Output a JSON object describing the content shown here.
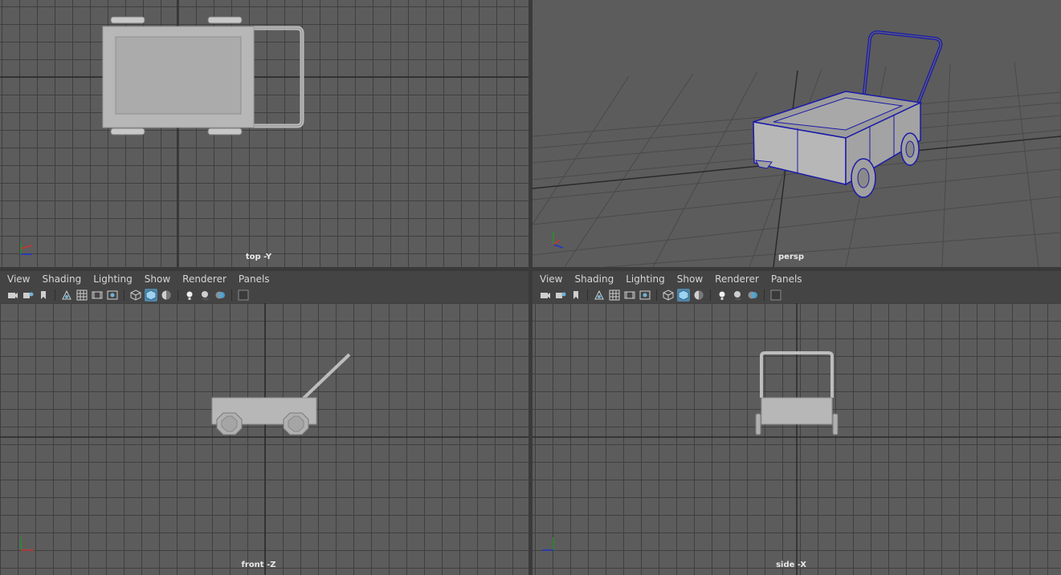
{
  "viewports": {
    "top": {
      "label": "top -Y"
    },
    "persp": {
      "label": "persp"
    },
    "front": {
      "label": "front -Z"
    },
    "side": {
      "label": "side -X"
    }
  },
  "panel_menu": {
    "view": "View",
    "shading": "Shading",
    "lighting": "Lighting",
    "show": "Show",
    "renderer": "Renderer",
    "panels": "Panels"
  },
  "axes": {
    "x": "x",
    "y": "y",
    "z": "z"
  },
  "colors": {
    "viewport_bg": "#5c5c5c",
    "grid_line": "#3f3f3f",
    "axis_line": "#2a2a2a",
    "wireframe_selected": "#1a1aa8",
    "model_gray": "#b3b3b3",
    "toolbar_active": "#5285a6"
  },
  "toolbar_icons": [
    "camera-icon",
    "camera-attr-icon",
    "bookmark-icon",
    "image-plane-icon",
    "grid-icon",
    "film-gate-icon",
    "resolution-gate-icon",
    "wireframe-icon",
    "smooth-shade-icon",
    "textured-icon",
    "lights-icon",
    "shadows-icon",
    "xray-icon",
    "isolate-icon"
  ]
}
